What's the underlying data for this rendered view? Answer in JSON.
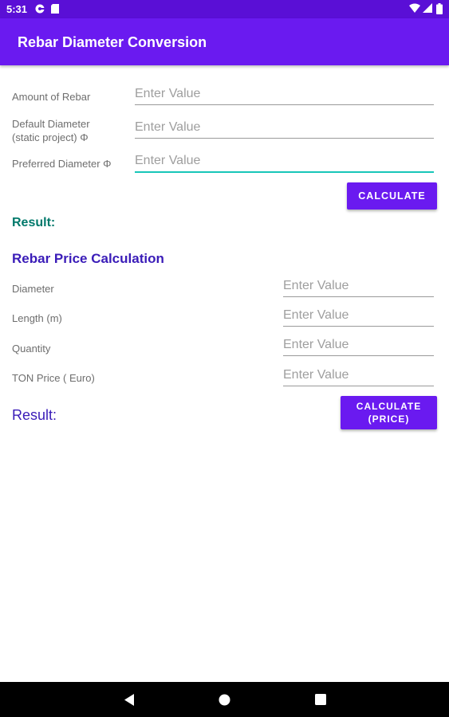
{
  "status_bar": {
    "time": "5:31",
    "icons": [
      "settings-gear-icon",
      "sd-card-icon",
      "wifi-icon",
      "signal-icon",
      "battery-icon"
    ]
  },
  "app_bar": {
    "title": "Rebar Diameter Conversion"
  },
  "conversion": {
    "fields": [
      {
        "label": "Amount of Rebar",
        "placeholder": "Enter Value"
      },
      {
        "label": "Default Diameter\n(static project) Φ",
        "placeholder": "Enter Value"
      },
      {
        "label": "Preferred Diameter Φ",
        "placeholder": "Enter Value"
      }
    ],
    "button_label": "CALCULATE",
    "result_label": "Result:"
  },
  "price": {
    "section_title": "Rebar Price Calculation",
    "fields": [
      {
        "label": "Diameter",
        "placeholder": "Enter Value"
      },
      {
        "label": "Length (m)",
        "placeholder": "Enter Value"
      },
      {
        "label": "Quantity",
        "placeholder": "Enter Value"
      },
      {
        "label": "TON Price ( Euro)",
        "placeholder": "Enter Value"
      }
    ],
    "result_label": "Result:",
    "button_label": "CALCULATE\n(PRICE)"
  },
  "colors": {
    "primary": "#6a1af0",
    "status_bar": "#5a0fd6",
    "accent": "#18c6b8",
    "result_teal": "#00796b",
    "section_title": "#3a1cb8"
  },
  "nav_bar": {
    "icons": [
      "back-icon",
      "home-icon",
      "recents-icon"
    ]
  }
}
